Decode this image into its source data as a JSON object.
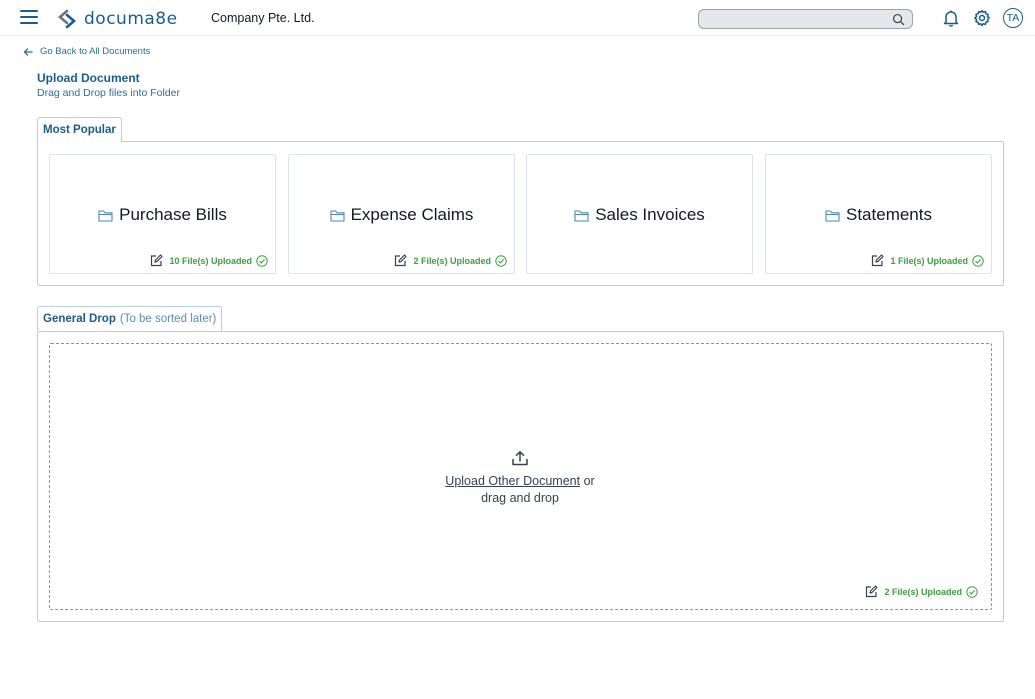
{
  "header": {
    "logo_text": "documa8e",
    "company": "Company Pte. Ltd.",
    "search_placeholder": "",
    "avatar_initials": "TA"
  },
  "nav": {
    "back_label": "Go Back to All Documents"
  },
  "page": {
    "title": "Upload Document",
    "subtitle": "Drag and Drop files into Folder"
  },
  "popular": {
    "tab_label": "Most Popular",
    "cards": [
      {
        "title": "Purchase Bills",
        "count": "10 File(s) Uploaded"
      },
      {
        "title": "Expense Claims",
        "count": "2 File(s) Uploaded"
      },
      {
        "title": "Sales Invoices",
        "count": ""
      },
      {
        "title": "Statements",
        "count": "1 File(s) Uploaded"
      }
    ]
  },
  "general": {
    "tab_label": "General Drop",
    "tab_sub": "(To be sorted later)",
    "upload_link": "Upload Other Document",
    "upload_or": " or",
    "upload_drag": "drag and drop",
    "count": "2 File(s) Uploaded"
  },
  "colors": {
    "brand": "#1a5d8c",
    "success": "#3ea03e",
    "border": "#b8cde0"
  },
  "icons": [
    "menu-icon",
    "logo-icon",
    "search-icon",
    "bell-icon",
    "gear-icon",
    "arrow-left-icon",
    "folder-icon",
    "edit-icon",
    "check-circle-icon",
    "upload-icon"
  ]
}
